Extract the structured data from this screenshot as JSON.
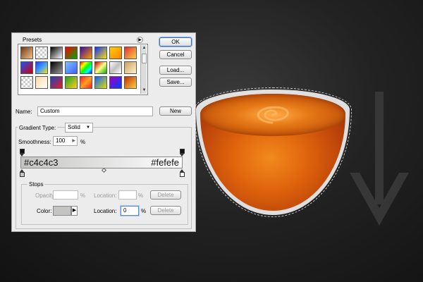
{
  "presets": {
    "label": "Presets",
    "menu_icon": "flyout-arrow-icon",
    "swatches": [
      "linear-gradient(135deg,#6b3a16,#f5c28a)",
      "repeating-conic-gradient(#ccc 0 25%, #fff 0 50%) 0 0/6px 6px",
      "linear-gradient(135deg,#000,#fff)",
      "linear-gradient(135deg,#f00,#0a0)",
      "linear-gradient(135deg,#3c0aa0,#ff9a00)",
      "linear-gradient(135deg,#1030ff,#ffe000)",
      "linear-gradient(135deg,#ffd000,#ff8000)",
      "linear-gradient(135deg,#e03030,#ffd040)",
      "linear-gradient(135deg,#2050ff,#c00)",
      "linear-gradient(135deg,#2040ff,#40a0ff,#ffe000)",
      "linear-gradient(135deg,#000,#999)",
      "linear-gradient(135deg,#80c0ff,#4060ff)",
      "linear-gradient(135deg,#f00,#ff0,#0f0,#0ff,#00f)",
      "linear-gradient(135deg,#c00,#ff8,#0a0)",
      "linear-gradient(135deg,#fff,#c0c0c0,#fff)",
      "linear-gradient(135deg,#caa060,#fff1c8)",
      "repeating-conic-gradient(#ccc 0 25%, #fff 0 50%) 0 0/6px 6px",
      "linear-gradient(135deg,#ffd8a0,#fff)",
      "linear-gradient(135deg,#2040c0,#e02020)",
      "linear-gradient(135deg,#20a020,#ffd020)",
      "linear-gradient(135deg,#ff2020,#ffa020,#ff2020)",
      "linear-gradient(135deg,#1060ff,#e0e000)",
      "linear-gradient(135deg,#a000c0,#0040ff)",
      "linear-gradient(135deg,#c03000,#ffd040)"
    ]
  },
  "buttons": {
    "ok": "OK",
    "cancel": "Cancel",
    "load": "Load...",
    "save": "Save...",
    "new": "New"
  },
  "name": {
    "label": "Name:",
    "value": "Custom"
  },
  "gradient": {
    "type_label": "Gradient Type:",
    "type_value": "Solid",
    "smoothness_label": "Smoothness:",
    "smoothness_value": "100",
    "smoothness_unit": "%",
    "start_color_text": "#c4c4c3",
    "end_color_text": "#fefefe",
    "start_color": "#c4c4c3",
    "end_color": "#fefefe"
  },
  "stops": {
    "label": "Stops",
    "opacity_label": "Opacity:",
    "opacity_unit": "%",
    "opacity_location_label": "Location:",
    "opacity_location_unit": "%",
    "opacity_delete": "Delete",
    "color_label": "Color:",
    "color_location_label": "Location:",
    "color_location_value": "0",
    "color_location_unit": "%",
    "color_delete": "Delete"
  }
}
